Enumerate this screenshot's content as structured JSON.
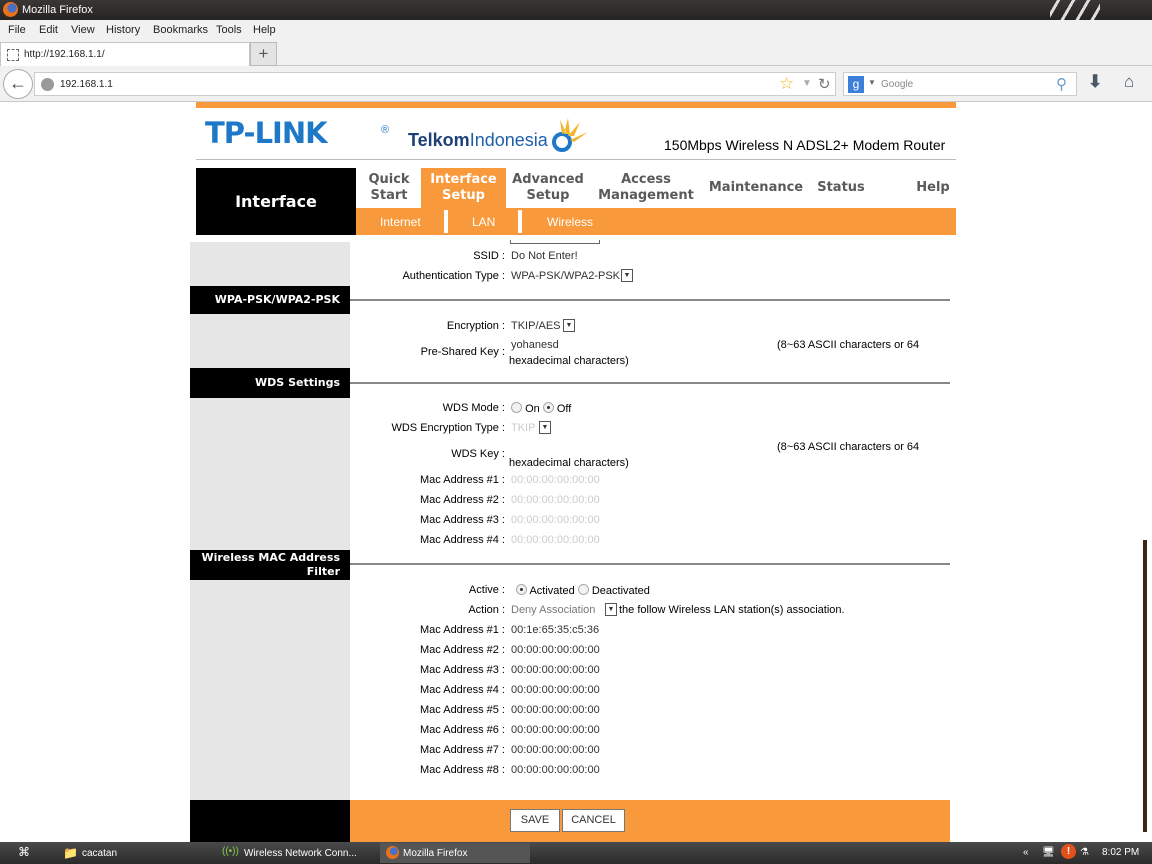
{
  "browser": {
    "window_title": "Mozilla Firefox",
    "menu": [
      "File",
      "Edit",
      "View",
      "History",
      "Bookmarks",
      "Tools",
      "Help"
    ],
    "tab_title": "http://192.168.1.1/",
    "new_tab": "+",
    "url": "192.168.1.1",
    "search_engine": "Google",
    "search_placeholder": "Google"
  },
  "router": {
    "brand": "TP-LINK",
    "brand_reg": "®",
    "partner_a": "Telkom",
    "partner_b": "Indonesia",
    "model": "150Mbps Wireless N ADSL2+ Modem Router",
    "section": "Interface",
    "nav": [
      {
        "label": "Quick Start",
        "active": false
      },
      {
        "label": "Interface Setup",
        "active": true
      },
      {
        "label": "Advanced Setup",
        "active": false
      },
      {
        "label": "Access Management",
        "active": false
      },
      {
        "label": "Maintenance",
        "active": false
      },
      {
        "label": "Status",
        "active": false
      },
      {
        "label": "Help",
        "active": false
      }
    ],
    "nav_lines": [
      [
        "Quick",
        "Start"
      ],
      [
        "Interface",
        "Setup"
      ],
      [
        "Advanced",
        "Setup"
      ],
      [
        "Access",
        "Management"
      ],
      [
        "Maintenance"
      ],
      [
        "Status"
      ],
      [
        "Help"
      ]
    ],
    "subnav": [
      "Internet",
      "LAN",
      "Wireless"
    ],
    "colors": {
      "accent": "#f8993c",
      "brand": "#1d78c7"
    }
  },
  "form": {
    "ssid_label": "SSID :",
    "ssid_value": "Do Not Enter!",
    "auth_label": "Authentication Type :",
    "auth_value": "WPA-PSK/WPA2-PSK",
    "wpa_section": "WPA-PSK/WPA2-PSK",
    "enc_label": "Encryption :",
    "enc_value": "TKIP/AES",
    "psk_label": "Pre-Shared Key :",
    "psk_value": "yohanesd",
    "key_note_a": "(8~63 ASCII characters or 64",
    "key_note_b": "hexadecimal characters)",
    "wds_section": "WDS Settings",
    "wds_mode_label": "WDS Mode :",
    "wds_on": "On",
    "wds_off": "Off",
    "wds_mode": "Off",
    "wds_enc_label": "WDS Encryption Type :",
    "wds_enc_value": "TKIP",
    "wds_key_label": "WDS Key :",
    "wds_key_value": "",
    "wds_macs": [
      {
        "label": "Mac Address #1 :",
        "value": "00:00:00:00:00:00"
      },
      {
        "label": "Mac Address #2 :",
        "value": "00:00:00:00:00:00"
      },
      {
        "label": "Mac Address #3 :",
        "value": "00:00:00:00:00:00"
      },
      {
        "label": "Mac Address #4 :",
        "value": "00:00:00:00:00:00"
      }
    ],
    "mac_filter_section_a": "Wireless MAC Address",
    "mac_filter_section_b": "Filter",
    "active_label": "Active :",
    "activated": "Activated",
    "deactivated": "Deactivated",
    "active_state": "Activated",
    "action_label": "Action :",
    "action_value": "Deny Association",
    "action_suffix": "the follow Wireless LAN station(s) association.",
    "filter_macs": [
      {
        "label": "Mac Address #1 :",
        "value": "00:1e:65:35:c5:36"
      },
      {
        "label": "Mac Address #2 :",
        "value": "00:00:00:00:00:00"
      },
      {
        "label": "Mac Address #3 :",
        "value": "00:00:00:00:00:00"
      },
      {
        "label": "Mac Address #4 :",
        "value": "00:00:00:00:00:00"
      },
      {
        "label": "Mac Address #5 :",
        "value": "00:00:00:00:00:00"
      },
      {
        "label": "Mac Address #6 :",
        "value": "00:00:00:00:00:00"
      },
      {
        "label": "Mac Address #7 :",
        "value": "00:00:00:00:00:00"
      },
      {
        "label": "Mac Address #8 :",
        "value": "00:00:00:00:00:00"
      }
    ],
    "save": "SAVE",
    "cancel": "CANCEL"
  },
  "taskbar": {
    "items": [
      "cacatan",
      "Wireless Network Conn...",
      "Mozilla Firefox"
    ],
    "clock": "8:02 PM"
  }
}
